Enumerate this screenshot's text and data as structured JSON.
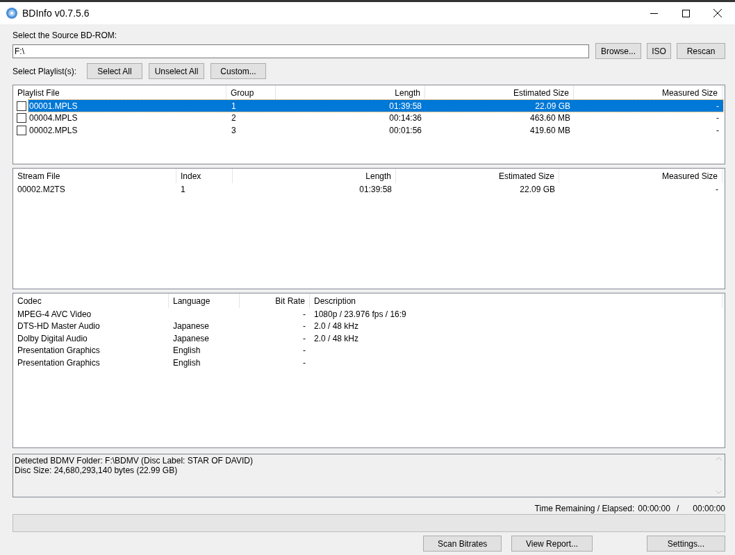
{
  "window": {
    "title": "BDInfo v0.7.5.6"
  },
  "source": {
    "label": "Select the Source BD-ROM:",
    "value": "F:\\",
    "buttons": [
      "Browse...",
      "ISO",
      "Rescan"
    ]
  },
  "playlist_select": {
    "label": "Select Playlist(s):",
    "buttons": [
      "Select All",
      "Unselect All",
      "Custom..."
    ]
  },
  "playlists": {
    "columns": [
      "Playlist File",
      "Group",
      "Length",
      "Estimated Size",
      "Measured Size"
    ],
    "rows": [
      {
        "checked": false,
        "selected": true,
        "cells": [
          "00001.MPLS",
          "1",
          "01:39:58",
          "22.09 GB",
          "-"
        ]
      },
      {
        "checked": false,
        "selected": false,
        "cells": [
          "00004.MPLS",
          "2",
          "00:14:36",
          "463.60 MB",
          "-"
        ]
      },
      {
        "checked": false,
        "selected": false,
        "cells": [
          "00002.MPLS",
          "3",
          "00:01:56",
          "419.60 MB",
          "-"
        ]
      }
    ]
  },
  "streams": {
    "columns": [
      "Stream File",
      "Index",
      "Length",
      "Estimated Size",
      "Measured Size"
    ],
    "rows": [
      {
        "cells": [
          "00002.M2TS",
          "1",
          "01:39:58",
          "22.09 GB",
          "-"
        ]
      }
    ]
  },
  "codecs": {
    "columns": [
      "Codec",
      "Language",
      "Bit Rate",
      "Description"
    ],
    "rows": [
      {
        "cells": [
          "MPEG-4 AVC Video",
          "",
          "-",
          "1080p / 23.976 fps / 16:9"
        ]
      },
      {
        "cells": [
          "DTS-HD Master Audio",
          "Japanese",
          "-",
          "2.0 / 48 kHz"
        ]
      },
      {
        "cells": [
          "Dolby Digital Audio",
          "Japanese",
          "-",
          "2.0 / 48 kHz"
        ]
      },
      {
        "cells": [
          "Presentation Graphics",
          "English",
          "-",
          ""
        ]
      },
      {
        "cells": [
          "Presentation Graphics",
          "English",
          "-",
          ""
        ]
      }
    ]
  },
  "log": [
    "Detected BDMV Folder: F:\\BDMV (Disc Label: STAR OF DAVID)",
    "Disc Size: 24,680,293,140 bytes (22.99 GB)"
  ],
  "time": {
    "label": "Time Remaining / Elapsed:",
    "remaining": "00:00:00",
    "separator": "/",
    "elapsed": "00:00:00"
  },
  "progress": {
    "level": 0
  },
  "bottom_buttons": [
    "Scan Bitrates",
    "View Report...",
    "Settings..."
  ]
}
